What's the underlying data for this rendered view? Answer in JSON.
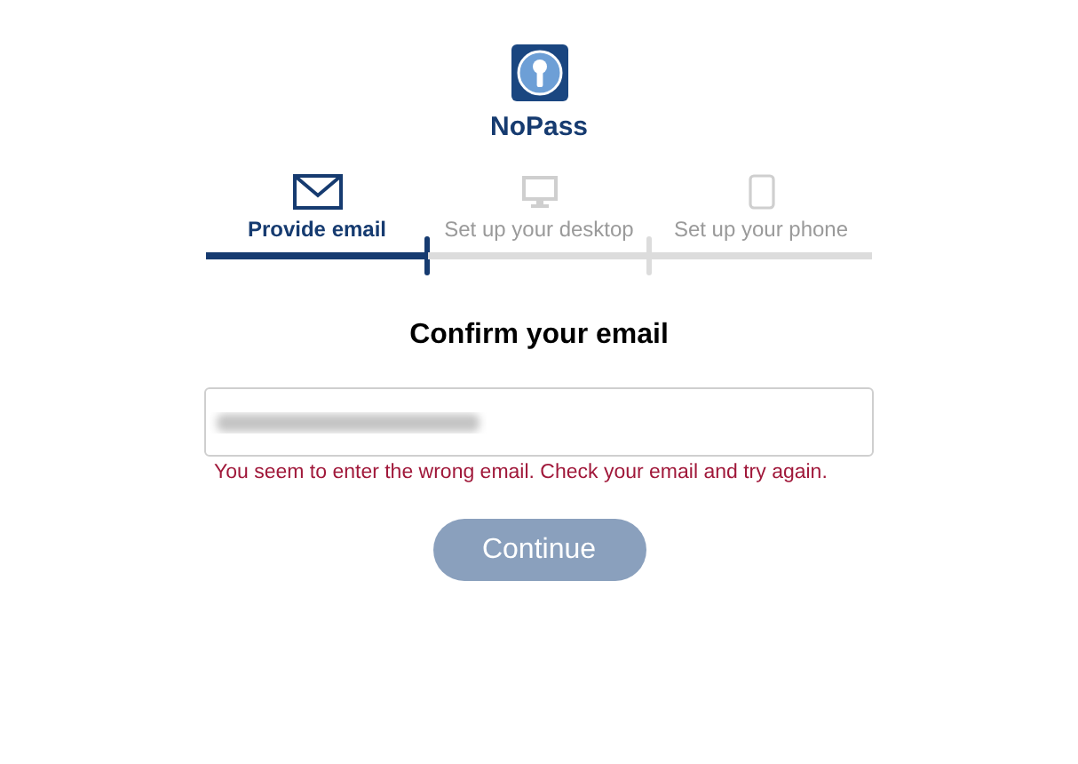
{
  "brand": {
    "name": "NoPass"
  },
  "steps": [
    {
      "kind": "email",
      "label": "Provide email",
      "selected": true
    },
    {
      "kind": "desktop",
      "label": "Set up your desktop",
      "selected": false
    },
    {
      "kind": "phone",
      "label": "Set up your phone",
      "selected": false
    }
  ],
  "heading": "Confirm your email",
  "email_field": {
    "error": "You seem to enter the wrong email. Check your email and try again."
  },
  "continue_button": {
    "label": "Continue",
    "disabled": true
  }
}
